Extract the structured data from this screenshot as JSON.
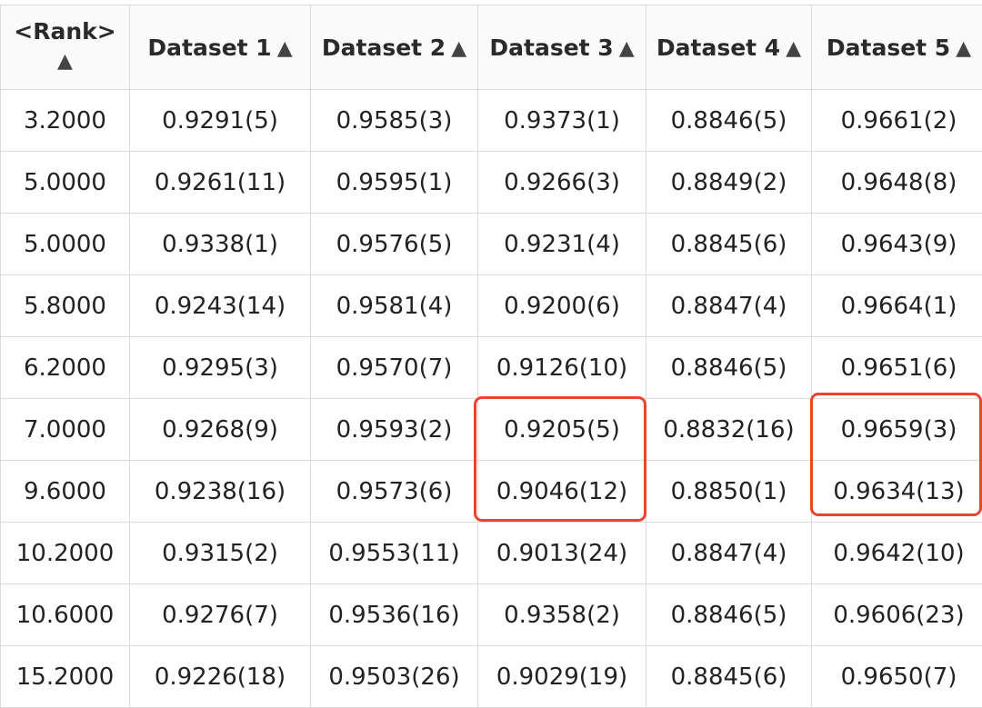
{
  "table": {
    "headers": [
      {
        "label": "<Rank>",
        "sort_icon": "▲"
      },
      {
        "label": "Dataset 1",
        "sort_icon": "▲"
      },
      {
        "label": "Dataset 2",
        "sort_icon": "▲"
      },
      {
        "label": "Dataset 3",
        "sort_icon": "▲"
      },
      {
        "label": "Dataset 4",
        "sort_icon": "▲"
      },
      {
        "label": "Dataset 5",
        "sort_icon": "▲"
      }
    ],
    "rows": [
      [
        "3.2000",
        "0.9291(5)",
        "0.9585(3)",
        "0.9373(1)",
        "0.8846(5)",
        "0.9661(2)"
      ],
      [
        "5.0000",
        "0.9261(11)",
        "0.9595(1)",
        "0.9266(3)",
        "0.8849(2)",
        "0.9648(8)"
      ],
      [
        "5.0000",
        "0.9338(1)",
        "0.9576(5)",
        "0.9231(4)",
        "0.8845(6)",
        "0.9643(9)"
      ],
      [
        "5.8000",
        "0.9243(14)",
        "0.9581(4)",
        "0.9200(6)",
        "0.8847(4)",
        "0.9664(1)"
      ],
      [
        "6.2000",
        "0.9295(3)",
        "0.9570(7)",
        "0.9126(10)",
        "0.8846(5)",
        "0.9651(6)"
      ],
      [
        "7.0000",
        "0.9268(9)",
        "0.9593(2)",
        "0.9205(5)",
        "0.8832(16)",
        "0.9659(3)"
      ],
      [
        "9.6000",
        "0.9238(16)",
        "0.9573(6)",
        "0.9046(12)",
        "0.8850(1)",
        "0.9634(13)"
      ],
      [
        "10.2000",
        "0.9315(2)",
        "0.9553(11)",
        "0.9013(24)",
        "0.8847(4)",
        "0.9642(10)"
      ],
      [
        "10.6000",
        "0.9276(7)",
        "0.9536(16)",
        "0.9358(2)",
        "0.8846(5)",
        "0.9606(23)"
      ],
      [
        "15.2000",
        "0.9226(18)",
        "0.9503(26)",
        "0.9029(19)",
        "0.8845(6)",
        "0.9650(7)"
      ]
    ]
  },
  "highlight_color": "#e8452c",
  "border_color": "#dcdcdc"
}
